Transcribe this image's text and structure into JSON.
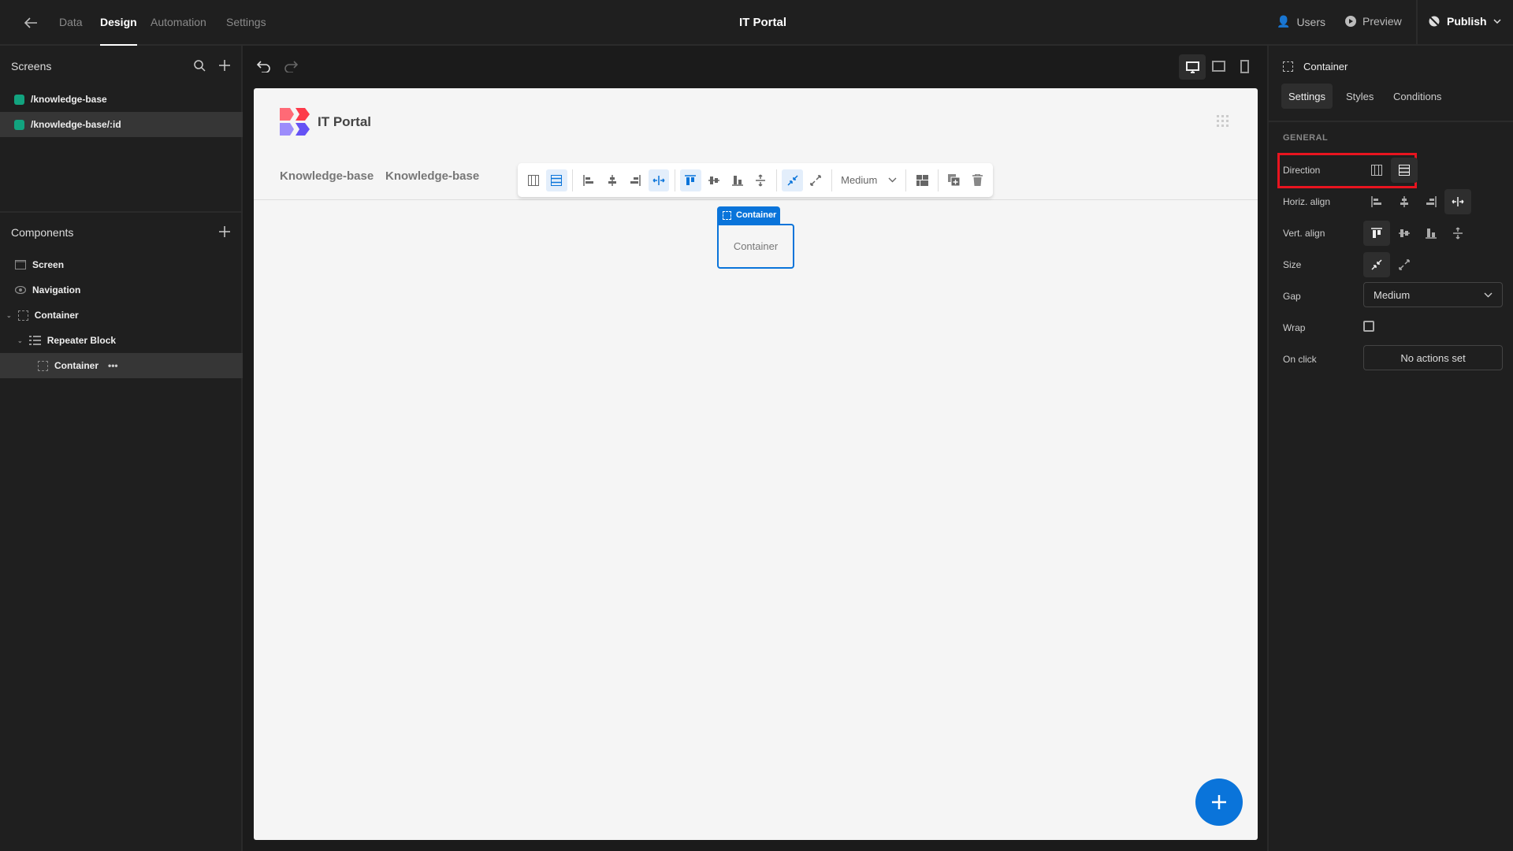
{
  "topbar": {
    "tabs": [
      {
        "label": "Data"
      },
      {
        "label": "Design"
      },
      {
        "label": "Automation"
      },
      {
        "label": "Settings"
      }
    ],
    "app_title": "IT Portal",
    "users": "Users",
    "preview": "Preview",
    "publish": "Publish"
  },
  "screens": {
    "title": "Screens",
    "items": [
      {
        "label": "/knowledge-base"
      },
      {
        "label": "/knowledge-base/:id"
      }
    ]
  },
  "components": {
    "title": "Components",
    "items": [
      {
        "label": "Screen",
        "icon": "screen-icon"
      },
      {
        "label": "Navigation",
        "icon": "eye-icon"
      },
      {
        "label": "Container",
        "icon": "container-icon"
      },
      {
        "label": "Repeater Block",
        "icon": "list-icon"
      },
      {
        "label": "Container",
        "icon": "container-icon"
      }
    ]
  },
  "preview": {
    "app_title": "IT Portal",
    "links": [
      "Knowledge-base",
      "Knowledge-base"
    ],
    "gap_value": "Medium",
    "selected_label": "Container",
    "selected_text": "Container"
  },
  "panel": {
    "title": "Container",
    "tabs": [
      "Settings",
      "Styles",
      "Conditions"
    ],
    "section": "GENERAL",
    "direction": "Direction",
    "horiz": "Horiz. align",
    "vert": "Vert. align",
    "size": "Size",
    "gap": "Gap",
    "gap_value": "Medium",
    "wrap": "Wrap",
    "wrap_checked": false,
    "onclick": "On click",
    "onclick_value": "No actions set"
  },
  "colors": {
    "accent": "#0a74da",
    "screen_dot": "#12a37f",
    "highlight": "#e8141f"
  }
}
